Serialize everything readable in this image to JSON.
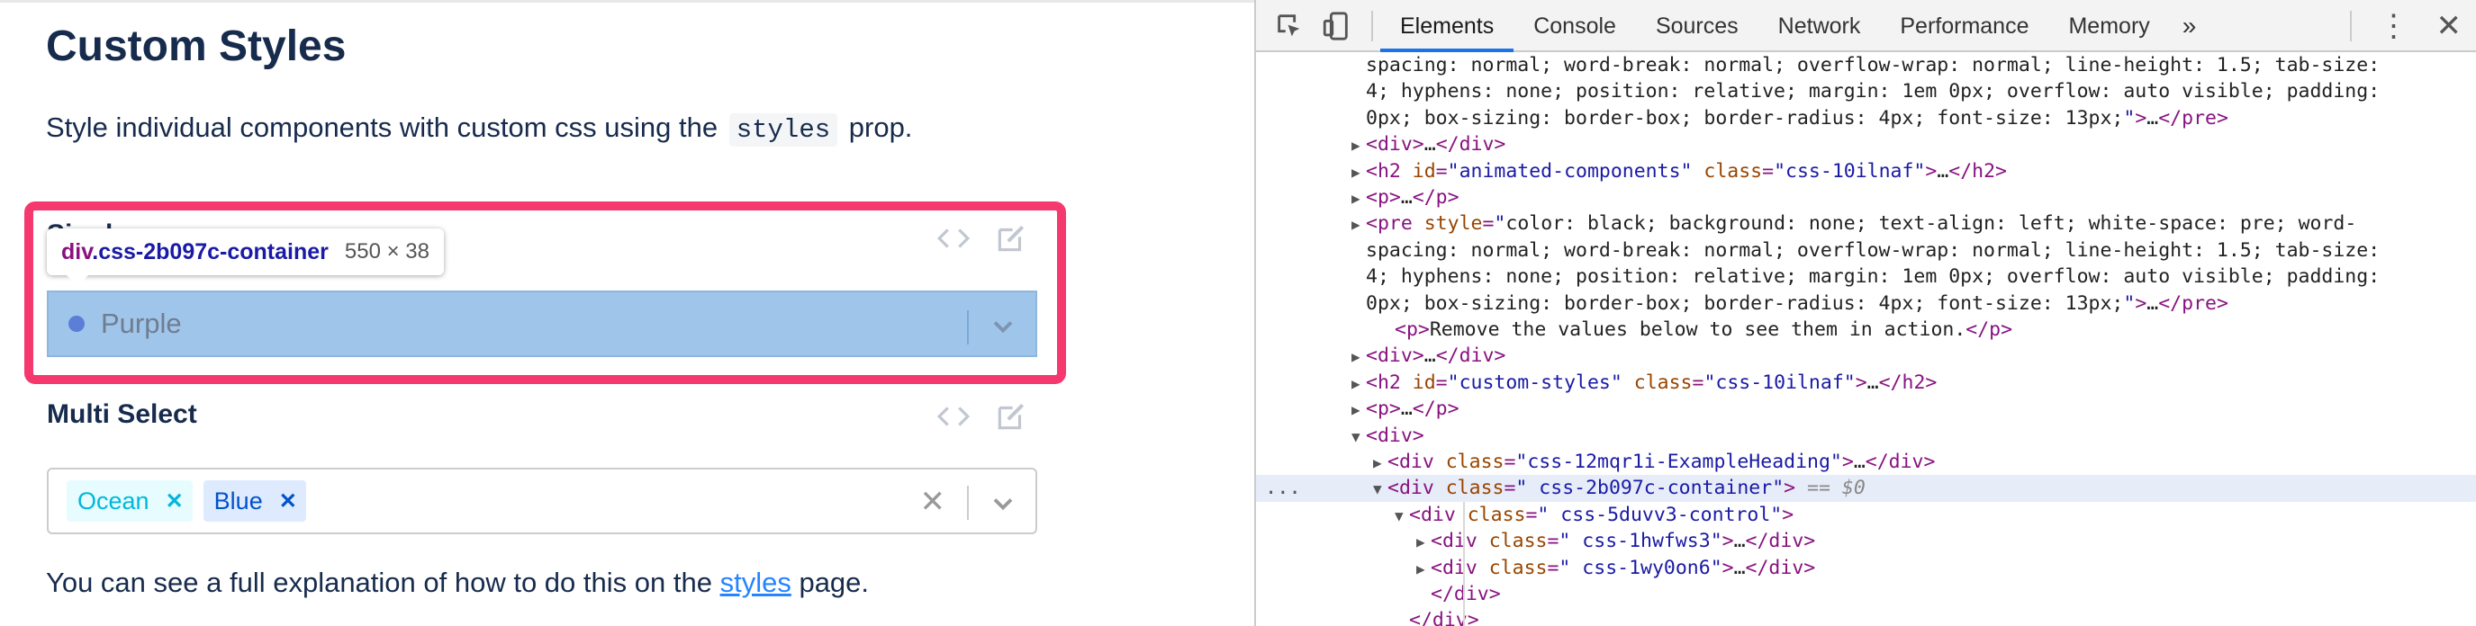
{
  "left": {
    "title": "Custom Styles",
    "intro_prefix": "Style individual components with custom css using the",
    "intro_code": "styles",
    "intro_suffix": "prop.",
    "single_label": "Single",
    "tooltip": {
      "tag": "div",
      "class": ".css-2b097c-container",
      "size": "550 × 38"
    },
    "single_value": "Purple",
    "multi_label": "Multi Select",
    "chips": [
      {
        "label": "Ocean"
      },
      {
        "label": "Blue"
      }
    ],
    "clear_glyph": "✕",
    "chip_remove_glyph": "✕",
    "footer_prefix": "You can see a full explanation of how to do this on the",
    "footer_link": "styles",
    "footer_suffix": "page.",
    "colors": {
      "highlight": "#f5386e",
      "select_overlay": "#9fc5ea",
      "link": "#2684ff"
    }
  },
  "devtools": {
    "tabs": [
      "Elements",
      "Console",
      "Sources",
      "Network",
      "Performance",
      "Memory"
    ],
    "active_tab": "Elements",
    "more_tabs": "»",
    "menu_glyph": "⋮",
    "close_glyph": "✕",
    "selected_marker": "...",
    "lines": [
      {
        "indent": 0,
        "tri": "",
        "parts": [
          {
            "c": "ct",
            "t": "spacing: normal; word-break: normal; overflow-wrap: normal; line-height: 1.5; tab-size:"
          }
        ]
      },
      {
        "indent": 0,
        "tri": "",
        "parts": [
          {
            "c": "ct",
            "t": "4; hyphens: none; position: relative; margin: 1em 0px; overflow: auto visible; padding:"
          }
        ]
      },
      {
        "indent": 0,
        "tri": "",
        "parts": [
          {
            "c": "ct",
            "t": "0px; box-sizing: border-box; border-radius: 4px; font-size: 13px;"
          },
          {
            "c": "av",
            "t": "\""
          },
          {
            "c": "tg",
            "t": ">"
          },
          {
            "c": "ct",
            "t": "…"
          },
          {
            "c": "tg",
            "t": "</pre>"
          }
        ]
      },
      {
        "indent": 0,
        "tri": "▶",
        "parts": [
          {
            "c": "tg",
            "t": "<div>"
          },
          {
            "c": "ct",
            "t": "…"
          },
          {
            "c": "tg",
            "t": "</div>"
          }
        ]
      },
      {
        "indent": 0,
        "tri": "▶",
        "parts": [
          {
            "c": "tg",
            "t": "<h2 "
          },
          {
            "c": "an",
            "t": "id"
          },
          {
            "c": "tg",
            "t": "="
          },
          {
            "c": "av",
            "t": "\"animated-components\""
          },
          {
            "c": "tg",
            "t": " "
          },
          {
            "c": "an",
            "t": "class"
          },
          {
            "c": "tg",
            "t": "="
          },
          {
            "c": "av",
            "t": "\"css-10ilnaf\""
          },
          {
            "c": "tg",
            "t": ">"
          },
          {
            "c": "ct",
            "t": "…"
          },
          {
            "c": "tg",
            "t": "</h2>"
          }
        ]
      },
      {
        "indent": 0,
        "tri": "▶",
        "parts": [
          {
            "c": "tg",
            "t": "<p>"
          },
          {
            "c": "ct",
            "t": "…"
          },
          {
            "c": "tg",
            "t": "</p>"
          }
        ]
      },
      {
        "indent": 0,
        "tri": "▶",
        "parts": [
          {
            "c": "tg",
            "t": "<pre "
          },
          {
            "c": "an",
            "t": "style"
          },
          {
            "c": "tg",
            "t": "="
          },
          {
            "c": "av",
            "t": "\""
          },
          {
            "c": "ct",
            "t": "color: black; background: none; text-align: left; white-space: pre; word-"
          }
        ]
      },
      {
        "indent": 0,
        "tri": "",
        "parts": [
          {
            "c": "ct",
            "t": "spacing: normal; word-break: normal; overflow-wrap: normal; line-height: 1.5; tab-size:"
          }
        ]
      },
      {
        "indent": 0,
        "tri": "",
        "parts": [
          {
            "c": "ct",
            "t": "4; hyphens: none; position: relative; margin: 1em 0px; overflow: auto visible; padding:"
          }
        ]
      },
      {
        "indent": 0,
        "tri": "",
        "parts": [
          {
            "c": "ct",
            "t": "0px; box-sizing: border-box; border-radius: 4px; font-size: 13px;"
          },
          {
            "c": "av",
            "t": "\""
          },
          {
            "c": "tg",
            "t": ">"
          },
          {
            "c": "ct",
            "t": "…"
          },
          {
            "c": "tg",
            "t": "</pre>"
          }
        ]
      },
      {
        "indent": 0,
        "tri": "",
        "parts": [
          {
            "c": "tg",
            "t": "<p>"
          },
          {
            "c": "ct",
            "t": "Remove the values below to see them in action."
          },
          {
            "c": "tg",
            "t": "</p>"
          }
        ]
      },
      {
        "indent": 0,
        "tri": "▶",
        "parts": [
          {
            "c": "tg",
            "t": "<div>"
          },
          {
            "c": "ct",
            "t": "…"
          },
          {
            "c": "tg",
            "t": "</div>"
          }
        ]
      },
      {
        "indent": 0,
        "tri": "▶",
        "parts": [
          {
            "c": "tg",
            "t": "<h2 "
          },
          {
            "c": "an",
            "t": "id"
          },
          {
            "c": "tg",
            "t": "="
          },
          {
            "c": "av",
            "t": "\"custom-styles\""
          },
          {
            "c": "tg",
            "t": " "
          },
          {
            "c": "an",
            "t": "class"
          },
          {
            "c": "tg",
            "t": "="
          },
          {
            "c": "av",
            "t": "\"css-10ilnaf\""
          },
          {
            "c": "tg",
            "t": ">"
          },
          {
            "c": "ct",
            "t": "…"
          },
          {
            "c": "tg",
            "t": "</h2>"
          }
        ]
      },
      {
        "indent": 0,
        "tri": "▶",
        "parts": [
          {
            "c": "tg",
            "t": "<p>"
          },
          {
            "c": "ct",
            "t": "…"
          },
          {
            "c": "tg",
            "t": "</p>"
          }
        ]
      },
      {
        "indent": 0,
        "tri": "▼",
        "parts": [
          {
            "c": "tg",
            "t": "<div>"
          }
        ]
      },
      {
        "indent": 1,
        "tri": "▶",
        "parts": [
          {
            "c": "tg",
            "t": "<div "
          },
          {
            "c": "an",
            "t": "class"
          },
          {
            "c": "tg",
            "t": "="
          },
          {
            "c": "av",
            "t": "\"css-12mqr1i-ExampleHeading\""
          },
          {
            "c": "tg",
            "t": ">"
          },
          {
            "c": "ct",
            "t": "…"
          },
          {
            "c": "tg",
            "t": "</div>"
          }
        ]
      },
      {
        "indent": 1,
        "tri": "▼",
        "selected": true,
        "parts": [
          {
            "c": "tg",
            "t": "<div "
          },
          {
            "c": "an",
            "t": "class"
          },
          {
            "c": "tg",
            "t": "="
          },
          {
            "c": "av",
            "t": "\" css-2b097c-container\""
          },
          {
            "c": "tg",
            "t": ">"
          },
          {
            "c": "eqs",
            "t": " == $0"
          }
        ]
      },
      {
        "indent": 2,
        "tri": "▼",
        "parts": [
          {
            "c": "tg",
            "t": "<div "
          },
          {
            "c": "an",
            "t": "class"
          },
          {
            "c": "tg",
            "t": "="
          },
          {
            "c": "av",
            "t": "\" css-5duvv3-control\""
          },
          {
            "c": "tg",
            "t": ">"
          }
        ]
      },
      {
        "indent": 3,
        "tri": "▶",
        "parts": [
          {
            "c": "tg",
            "t": "<div "
          },
          {
            "c": "an",
            "t": "class"
          },
          {
            "c": "tg",
            "t": "="
          },
          {
            "c": "av",
            "t": "\" css-1hwfws3\""
          },
          {
            "c": "tg",
            "t": ">"
          },
          {
            "c": "ct",
            "t": "…"
          },
          {
            "c": "tg",
            "t": "</div>"
          }
        ]
      },
      {
        "indent": 3,
        "tri": "▶",
        "parts": [
          {
            "c": "tg",
            "t": "<div "
          },
          {
            "c": "an",
            "t": "class"
          },
          {
            "c": "tg",
            "t": "="
          },
          {
            "c": "av",
            "t": "\" css-1wy0on6\""
          },
          {
            "c": "tg",
            "t": ">"
          },
          {
            "c": "ct",
            "t": "…"
          },
          {
            "c": "tg",
            "t": "</div>"
          }
        ]
      },
      {
        "indent": 3,
        "tri": "",
        "parts": [
          {
            "c": "tg",
            "t": "</div>"
          }
        ]
      },
      {
        "indent": 2,
        "tri": "",
        "parts": [
          {
            "c": "tg",
            "t": "</div>"
          }
        ]
      }
    ]
  }
}
